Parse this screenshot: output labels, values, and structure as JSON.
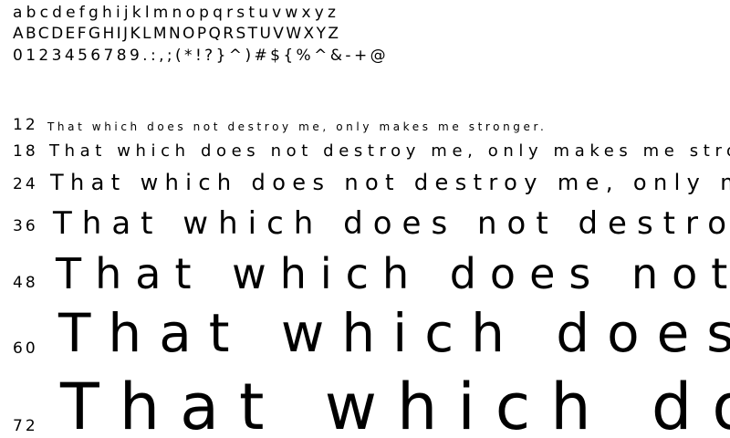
{
  "charset": {
    "lowercase": "abcdefghijklmnopqrstuvwxyz",
    "uppercase": "ABCDEFGHIJKLMNOPQRSTUVWXYZ",
    "digits_symbols": "0123456789.:,;(*!?}^)#${%^&-+@"
  },
  "sample_sentence": "That which does not destroy me, only makes me stronger.",
  "samples": [
    {
      "size_label": "12",
      "text": "That which does not destroy me, only makes me stronger."
    },
    {
      "size_label": "18",
      "text": "That which does not destroy me, only makes me stronger."
    },
    {
      "size_label": "24",
      "text": "That which does not destroy me, only makes me stronger."
    },
    {
      "size_label": "36",
      "text": "That which does not destroy me, only makes me stronger."
    },
    {
      "size_label": "48",
      "text": "That which does not destroy me, only makes me stronger."
    },
    {
      "size_label": "60",
      "text": "That which does not destroy me, only makes me stronger."
    },
    {
      "size_label": "72",
      "text": "That which does not destroy me, only makes me stronger."
    }
  ]
}
